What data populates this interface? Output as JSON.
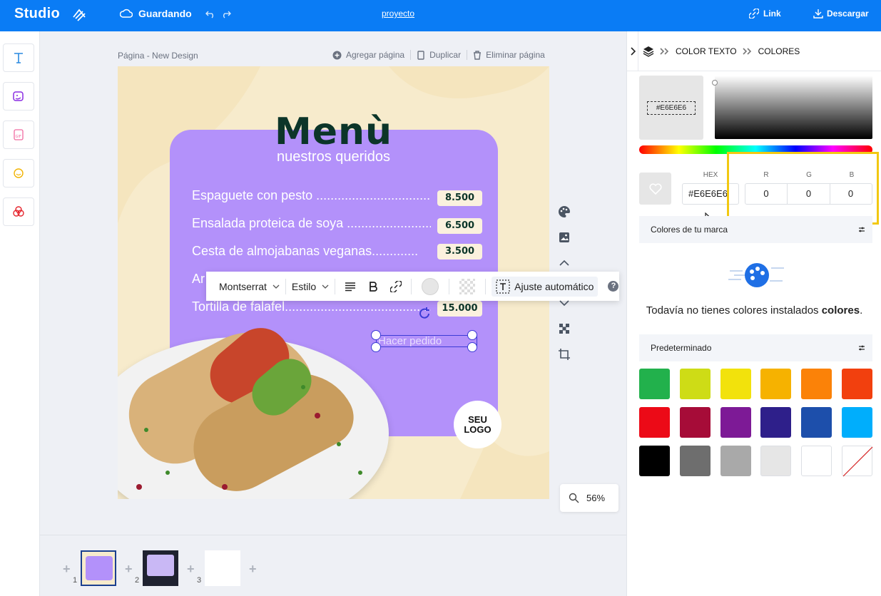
{
  "topbar": {
    "brand": "Studio",
    "saving": "Guardando",
    "project": "proyecto",
    "link": "Link",
    "download": "Descargar"
  },
  "canvas_header": {
    "page_label": "Página - New Design",
    "add_page": "Agregar página",
    "duplicate": "Duplicar",
    "delete_page": "Eliminar página"
  },
  "design": {
    "title": "Menù",
    "subtitle": "nuestros queridos",
    "items": [
      {
        "name": "Espaguete con pesto .......................................",
        "price": "8.500"
      },
      {
        "name": "Ensalada proteica de soya ........................",
        "price": "6.500"
      },
      {
        "name": "Cesta de almojabanas veganas.............",
        "price": "3.500"
      },
      {
        "name": "Ar",
        "price": ""
      },
      {
        "name": "Tortilla de falafel.................................................",
        "price": "15.000"
      }
    ],
    "order_text": "Hacer pedido",
    "logo_line1": "SEU",
    "logo_line2": "LOGO"
  },
  "text_toolbar": {
    "font": "Montserrat",
    "style": "Estilo",
    "auto_fit": "Ajuste automático",
    "help": "?"
  },
  "zoom": "56%",
  "pages": [
    "1",
    "2",
    "3"
  ],
  "right_panel": {
    "crumbs": [
      "COLOR TEXTO",
      "COLORES"
    ],
    "preview_hex": "#E6E6E6",
    "hex_label": "HEX",
    "hex_value": "#E6E6E6",
    "r_label": "R",
    "g_label": "G",
    "b_label": "B",
    "r_value": "0",
    "g_value": "0",
    "b_value": "0",
    "brand_colors_label": "Colores de tu marca",
    "empty_text_prefix": "Todavía no tienes colores instalados ",
    "empty_text_bold": "colores",
    "empty_text_suffix": ".",
    "default_label": "Predeterminado",
    "swatches": [
      "#22b14c",
      "#cedc16",
      "#f2e20c",
      "#f6b200",
      "#fb8208",
      "#f2400e",
      "#ec0a17",
      "#a60c38",
      "#7d1a96",
      "#2e1f8a",
      "#1d4fab",
      "#00aefc",
      "#000000",
      "#6e6e6e",
      "#a9a9a9",
      "#e6e6e6",
      "#ffffff",
      "none"
    ]
  },
  "colors": {
    "topbar": "#0a7cf5",
    "menu_card": "#b391fa",
    "highlight": "#f2c811"
  }
}
